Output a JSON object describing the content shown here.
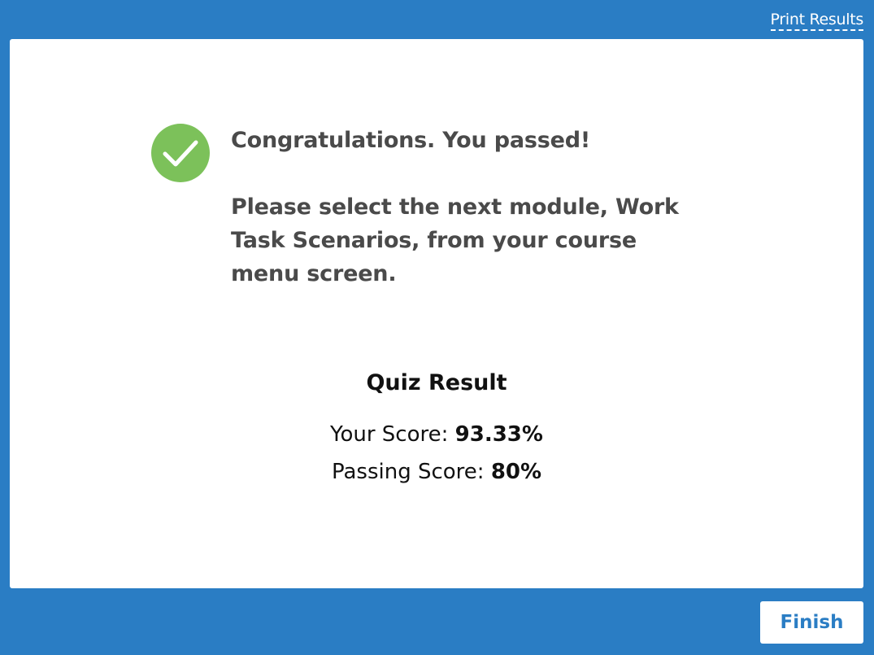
{
  "header": {
    "print_link": "Print Results"
  },
  "result": {
    "icon": "check-circle-icon",
    "icon_color": "#7cc15a",
    "headline": "Congratulations. You passed!",
    "instruction": "Please select the next module, Work Task Scenarios, from your course menu screen."
  },
  "quiz": {
    "title": "Quiz Result",
    "your_score_label": "Your Score:",
    "your_score_value": "93.33%",
    "passing_score_label": "Passing Score:",
    "passing_score_value": "80%"
  },
  "footer": {
    "finish_label": "Finish"
  },
  "colors": {
    "background": "#2a7dc4",
    "card": "#ffffff",
    "message_text": "#4a4a4a",
    "accent": "#2a7dc4"
  }
}
